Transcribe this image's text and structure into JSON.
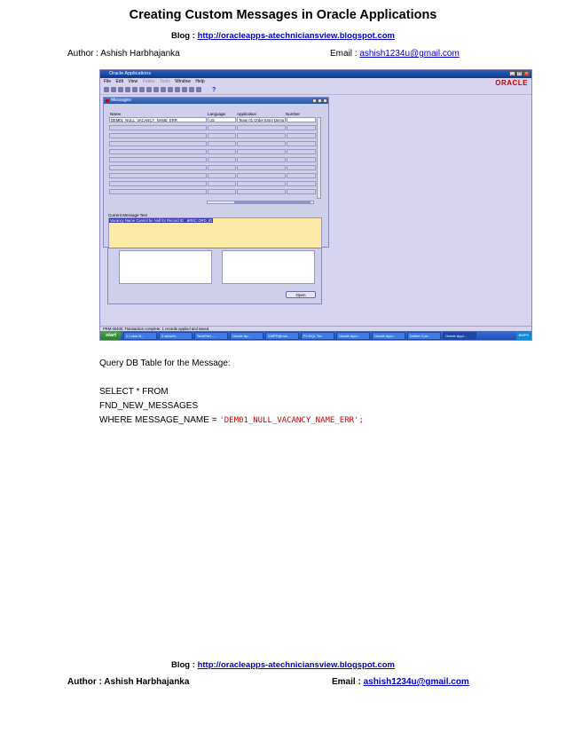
{
  "document": {
    "title": "Creating Custom Messages in Oracle Applications",
    "blog_label": "Blog : ",
    "blog_url": "http://oracleapps-atechniciansview.blogspot.com",
    "author": "Author : Ashish Harbhajanka",
    "email_label": "Email : ",
    "email": "ashish1234u@gmail.com"
  },
  "screenshot": {
    "window_title": "Oracle Applications",
    "menu": [
      "File",
      "Edit",
      "View",
      "Folder",
      "Tools",
      "Window",
      "Help"
    ],
    "brand": "ORACLE",
    "form_title": "Messages",
    "columns": [
      "Name",
      "Language",
      "Application",
      "Number"
    ],
    "row": {
      "name": "DEM01_NULL_VACANCY_NAME_ERR",
      "language": "US",
      "application": "Team 01 Order Entry Demo",
      "number": ""
    },
    "current_label": "Current Message Text",
    "current_text": "Vacancy Name Cannot be Null for Record ID : &REC ORD_ID",
    "open_button": "Open",
    "status": "FRM-40400: Transaction complete: 1 records applied and saved.",
    "start": "start",
    "tasks": [
      "2 Lotus N...",
      "2 ashwhi...",
      "TechPart -...",
      "Oracle Ap...",
      "XMPP@mai...",
      "PL/SQL Tut...",
      "Oracle Appl...",
      "Oracle Appl...",
      "Define Curr...",
      "Oracle Appl..."
    ],
    "tray": "BMPS"
  },
  "query": {
    "heading": "Query DB Table for the Message:",
    "line1": "SELECT * FROM",
    "line2": "FND_NEW_MESSAGES",
    "line3_prefix": "WHERE MESSAGE_NAME  = ",
    "line3_value": "'DEM01_NULL_VACANCY_NAME_ERR';"
  },
  "footer": {
    "blog_label": "Blog : ",
    "blog_url": "http://oracleapps-atechniciansview.blogspot.com",
    "author": "Author : Ashish Harbhajanka",
    "email_label": "Email : ",
    "email": "ashish1234u@gmail.com"
  }
}
